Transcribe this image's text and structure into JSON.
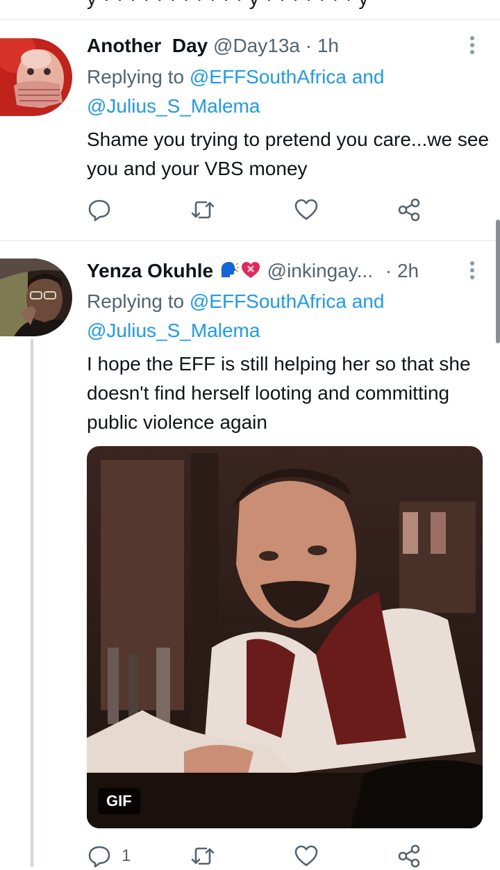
{
  "tweets": [
    {
      "name": "Another  Day",
      "handle": "@Day13a",
      "time": "· 1h",
      "replying_prefix": "Replying to ",
      "replying_to_1": "@EFFSouthAfrica",
      "replying_and": " and",
      "replying_to_2": "@Julius_S_Malema",
      "text": "Shame you trying to pretend you care...we see you and your VBS money",
      "avatar_icon": "avatar-photo-hand-over-mouth"
    },
    {
      "name": "Yenza Okuhle",
      "handle": "@inkingay...",
      "time": "· 2h",
      "emojis": [
        "speaking-head-emoji",
        "heart-with-ribbon-emoji"
      ],
      "replying_prefix": "Replying to ",
      "replying_to_1": "@EFFSouthAfrica",
      "replying_and": " and",
      "replying_to_2": "@Julius_S_Malema",
      "text": "I hope the EFF is still helping her so that she doesn't find herself looting and committing public violence again",
      "gif_label": "GIF",
      "reply_count": "1",
      "avatar_icon": "avatar-photo-man-with-glasses"
    }
  ],
  "icons": {
    "reply": "reply-icon",
    "retweet": "retweet-icon",
    "like": "like-icon",
    "share": "share-icon",
    "more": "more-options-icon"
  },
  "colors": {
    "link": "#1d9bf0",
    "muted": "#536471",
    "text": "#0f1419",
    "divider": "#e4e7ea"
  }
}
